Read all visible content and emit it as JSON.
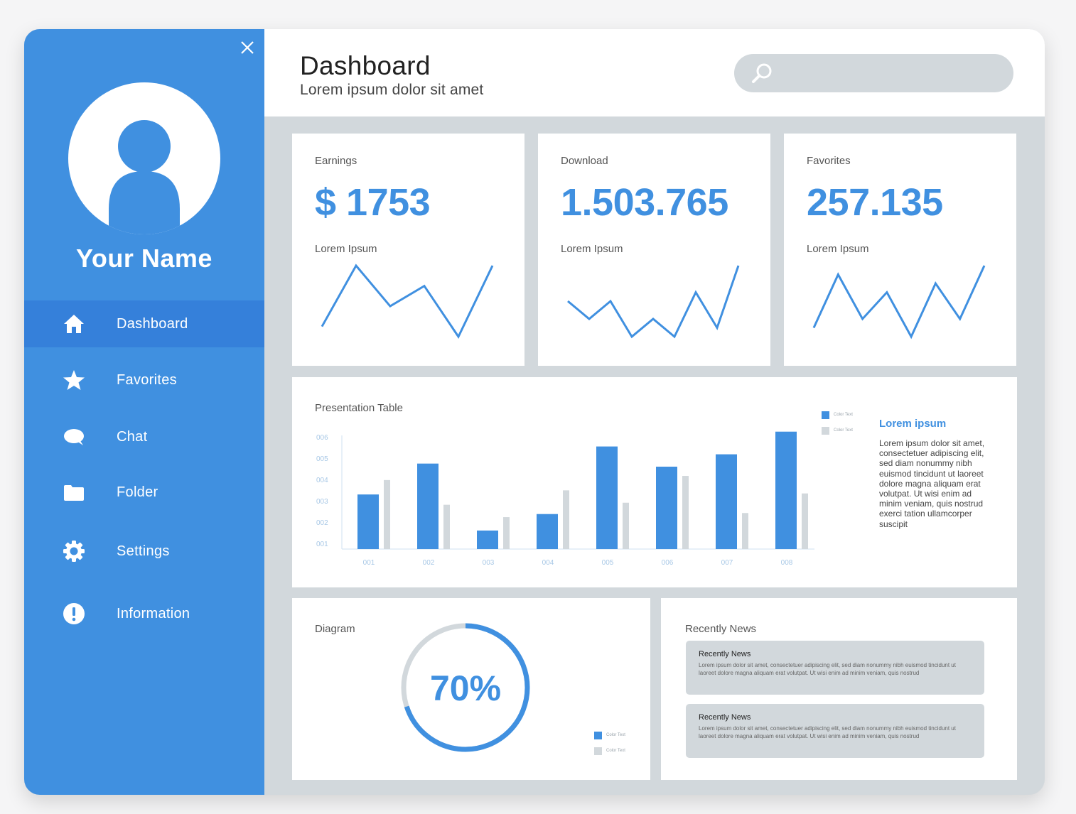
{
  "sidebar": {
    "user_name": "Your Name",
    "items": [
      {
        "label": "Dashboard",
        "icon": "home-icon",
        "active": true
      },
      {
        "label": "Favorites",
        "icon": "star-icon",
        "active": false
      },
      {
        "label": "Chat",
        "icon": "chat-bubble-icon",
        "active": false
      },
      {
        "label": "Folder",
        "icon": "folder-icon",
        "active": false
      },
      {
        "label": "Settings",
        "icon": "gear-icon",
        "active": false
      },
      {
        "label": "Information",
        "icon": "exclamation-icon",
        "active": false
      }
    ]
  },
  "header": {
    "title": "Dashboard",
    "subtitle": "Lorem ipsum dolor sit amet",
    "search_value": ""
  },
  "stats": [
    {
      "label": "Earnings",
      "value": "$ 1753",
      "sub": "Lorem Ipsum",
      "trend": [
        2,
        8,
        4,
        6,
        1,
        8
      ]
    },
    {
      "label": "Download",
      "value": "1.503.765",
      "sub": "Lorem Ipsum",
      "trend": [
        5,
        3,
        5,
        1,
        3,
        1,
        6,
        2,
        9
      ]
    },
    {
      "label": "Favorites",
      "value": "257.135",
      "sub": "Lorem Ipsum",
      "trend": [
        1,
        7,
        2,
        5,
        0,
        6,
        2,
        8
      ]
    }
  ],
  "presentation": {
    "title": "Presentation Table",
    "legend": [
      "Color Text",
      "Color Text"
    ],
    "side_title": "Lorem ipsum",
    "side_text": "Lorem ipsum dolor sit amet, consectetuer adipiscing elit, sed diam nonummy nibh euismod tincidunt ut laoreet dolore magna aliquam erat volutpat. Ut wisi enim ad minim veniam, quis nostrud exerci tation ullamcorper suscipit"
  },
  "chart_data": {
    "type": "bar",
    "categories": [
      "001",
      "002",
      "003",
      "004",
      "005",
      "006",
      "007",
      "008"
    ],
    "y_ticks": [
      "001",
      "002",
      "003",
      "004",
      "005",
      "006"
    ],
    "ylim": [
      0,
      6
    ],
    "series": [
      {
        "name": "Color Text",
        "color": "#4090e0",
        "values": [
          2.65,
          4.15,
          0.9,
          1.7,
          4.98,
          4.0,
          4.6,
          5.7
        ]
      },
      {
        "name": "Color Text",
        "color": "#d2d8dc",
        "values": [
          3.35,
          2.15,
          1.55,
          2.85,
          2.25,
          3.55,
          1.75,
          2.7
        ]
      }
    ],
    "grid": false
  },
  "diagram": {
    "title": "Diagram",
    "percent_label": "70%",
    "percent": 70,
    "legend": [
      "Color Text",
      "Color Text"
    ]
  },
  "news": {
    "title": "Recently News",
    "items": [
      {
        "title": "Recently News",
        "body": "Lorem ipsum dolor sit amet, consectetuer adipiscing elit, sed diam nonummy nibh euismod tincidunt ut laoreet dolore magna aliquam erat volutpat. Ut wisi enim ad minim veniam, quis nostrud"
      },
      {
        "title": "Recently News",
        "body": "Lorem ipsum dolor sit amet, consectetuer adipiscing elit, sed diam nonummy nibh euismod tincidunt ut laoreet dolore magna aliquam erat volutpat. Ut wisi enim ad minim veniam, quis nostrud"
      }
    ]
  },
  "colors": {
    "accent": "#4090e0",
    "accent_dark": "#3580da",
    "neutral": "#d2d8dc",
    "axis_text": "#a8c8e6"
  }
}
